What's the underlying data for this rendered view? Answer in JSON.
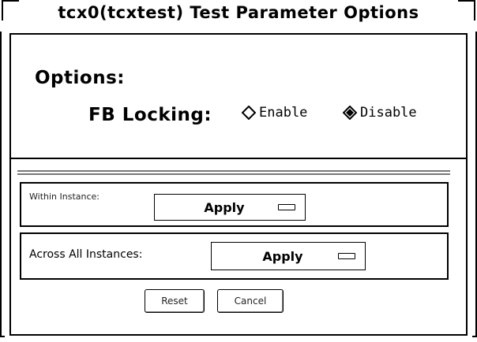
{
  "window": {
    "title": "tcx0(tcxtest) Test Parameter Options"
  },
  "options": {
    "heading": "Options:",
    "fb_locking": {
      "label": "FB Locking:",
      "choices": [
        {
          "label": "Enable",
          "selected": false
        },
        {
          "label": "Disable",
          "selected": true
        }
      ]
    }
  },
  "within_instance": {
    "label": "Within Instance:",
    "button": "Apply"
  },
  "across_instances": {
    "label": "Across All Instances:",
    "button": "Apply"
  },
  "buttons": {
    "reset": "Reset",
    "cancel": "Cancel"
  },
  "icons": {
    "radio_unselected": "diamond-outline-icon",
    "radio_selected": "diamond-filled-icon"
  }
}
